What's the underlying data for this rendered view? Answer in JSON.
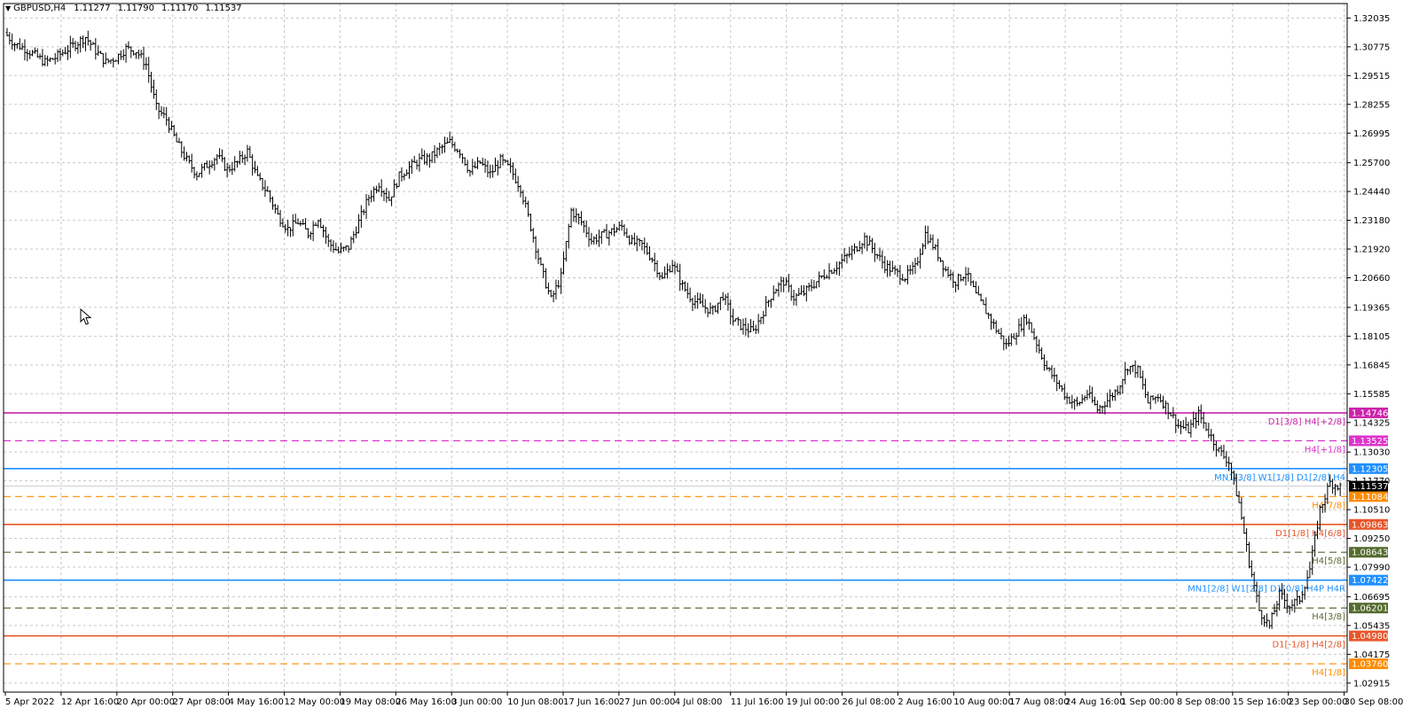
{
  "header": {
    "symbol_timeframe": "GBPUSD,H4",
    "open": "1.11277",
    "high": "1.11790",
    "low": "1.11170",
    "close": "1.11537",
    "collapse_icon": "triangle-down-icon"
  },
  "colors": {
    "grid": "#c8c8c8",
    "candle": "#000000",
    "axis": "#000000",
    "current_price_bg": "#000000",
    "magenta": "#cc22aa",
    "blue": "#1e90ff",
    "orange": "#ff8c00",
    "red_orange": "#e8552a",
    "olive": "#556b2f"
  },
  "price_axis": {
    "ticks": [
      "1.32035",
      "1.30775",
      "1.29515",
      "1.28255",
      "1.26995",
      "1.25700",
      "1.24440",
      "1.23180",
      "1.21920",
      "1.20660",
      "1.19365",
      "1.18105",
      "1.16845",
      "1.15585",
      "1.14325",
      "1.13030",
      "1.11770",
      "1.10510",
      "1.09250",
      "1.07990",
      "1.06695",
      "1.05435",
      "1.04175",
      "1.02915"
    ],
    "current_price": "1.11537"
  },
  "time_axis": {
    "labels": [
      "5 Apr 2022",
      "12 Apr 16:00",
      "20 Apr 00:00",
      "27 Apr 08:00",
      "4 May 16:00",
      "12 May 00:00",
      "19 May 08:00",
      "26 May 16:00",
      "3 Jun 00:00",
      "10 Jun 08:00",
      "17 Jun 16:00",
      "27 Jun 00:00",
      "4 Jul 08:00",
      "11 Jul 16:00",
      "19 Jul 00:00",
      "26 Jul 08:00",
      "2 Aug 16:00",
      "10 Aug 00:00",
      "17 Aug 08:00",
      "24 Aug 16:00",
      "1 Sep 00:00",
      "8 Sep 08:00",
      "15 Sep 16:00",
      "23 Sep 00:00",
      "30 Sep 08:00"
    ]
  },
  "levels": [
    {
      "price": 1.14746,
      "tag": "1.14746",
      "label": "D1[3/8] H4[+2/8]",
      "color": "#cc22aa",
      "dash": false
    },
    {
      "price": 1.13525,
      "tag": "1.13525",
      "label": "H4[+1/8]",
      "color": "#dd33cc",
      "dash": true
    },
    {
      "price": 1.12305,
      "tag": "1.12305",
      "label": "MN1[3/8] W1[1/8] D1[2/8] H4",
      "color": "#1e90ff",
      "dash": false
    },
    {
      "price": 1.11084,
      "tag": "1.11084",
      "label": "H4[7/8]",
      "color": "#ff8c00",
      "dash": true
    },
    {
      "price": 1.09863,
      "tag": "1.09863",
      "label": "D1[1/8] H4[6/8]",
      "color": "#e8552a",
      "dash": false
    },
    {
      "price": 1.08643,
      "tag": "1.08643",
      "label": "H4[5/8]",
      "color": "#556b2f",
      "dash": true
    },
    {
      "price": 1.07422,
      "tag": "1.07422",
      "label": "MN1[2/8] W1[2/8] D1[0/8] H4P H4R",
      "color": "#1e90ff",
      "dash": false
    },
    {
      "price": 1.06201,
      "tag": "1.06201",
      "label": "H4[3/8]",
      "color": "#556b2f",
      "dash": true
    },
    {
      "price": 1.0498,
      "tag": "1.04980",
      "label": "D1[-1/8] H4[2/8]",
      "color": "#e8552a",
      "dash": false
    },
    {
      "price": 1.0376,
      "tag": "1.03760",
      "label": "H4[1/8]",
      "color": "#ff8c00",
      "dash": true
    }
  ],
  "chart_data": {
    "type": "line",
    "subtype": "ohlc_bars",
    "title": "GBPUSD,H4",
    "xlabel": "",
    "ylabel": "",
    "ylim": [
      1.0252,
      1.3267
    ],
    "grid": true,
    "x_labels": [
      "5 Apr 2022",
      "12 Apr 16:00",
      "20 Apr 00:00",
      "27 Apr 08:00",
      "4 May 16:00",
      "12 May 00:00",
      "19 May 08:00",
      "26 May 16:00",
      "3 Jun 00:00",
      "10 Jun 08:00",
      "17 Jun 16:00",
      "27 Jun 00:00",
      "4 Jul 08:00",
      "11 Jul 16:00",
      "19 Jul 00:00",
      "26 Jul 08:00",
      "2 Aug 16:00",
      "10 Aug 00:00",
      "17 Aug 08:00",
      "24 Aug 16:00",
      "1 Sep 00:00",
      "8 Sep 08:00",
      "15 Sep 16:00",
      "23 Sep 00:00",
      "30 Sep 08:00"
    ],
    "series": [
      {
        "values": [
          1.314,
          1.309,
          1.307,
          1.304,
          1.301,
          1.303,
          1.306,
          1.309,
          1.312,
          1.306,
          1.301,
          1.303,
          1.307,
          1.306,
          1.3,
          1.281,
          1.276,
          1.266,
          1.258,
          1.252,
          1.256,
          1.26,
          1.254,
          1.257,
          1.262,
          1.25,
          1.244,
          1.234,
          1.228,
          1.231,
          1.226,
          1.233,
          1.222,
          1.218,
          1.22,
          1.231,
          1.242,
          1.248,
          1.241,
          1.251,
          1.255,
          1.258,
          1.259,
          1.263,
          1.266,
          1.262,
          1.253,
          1.257,
          1.252,
          1.258,
          1.254,
          1.246,
          1.229,
          1.211,
          1.197,
          1.207,
          1.236,
          1.231,
          1.223,
          1.225,
          1.227,
          1.229,
          1.222,
          1.221,
          1.215,
          1.206,
          1.213,
          1.203,
          1.197,
          1.194,
          1.192,
          1.199,
          1.188,
          1.185,
          1.183,
          1.192,
          1.201,
          1.205,
          1.198,
          1.2,
          1.204,
          1.208,
          1.211,
          1.215,
          1.219,
          1.224,
          1.218,
          1.212,
          1.209,
          1.207,
          1.211,
          1.226,
          1.219,
          1.21,
          1.205,
          1.209,
          1.199,
          1.192,
          1.184,
          1.177,
          1.183,
          1.189,
          1.178,
          1.167,
          1.161,
          1.154,
          1.151,
          1.156,
          1.149,
          1.153,
          1.158,
          1.168,
          1.166,
          1.152,
          1.155,
          1.149,
          1.142,
          1.14,
          1.147,
          1.139,
          1.131,
          1.126,
          1.108,
          1.082,
          1.061,
          1.054,
          1.068,
          1.063,
          1.066,
          1.079,
          1.105,
          1.117,
          1.115
        ]
      }
    ]
  }
}
